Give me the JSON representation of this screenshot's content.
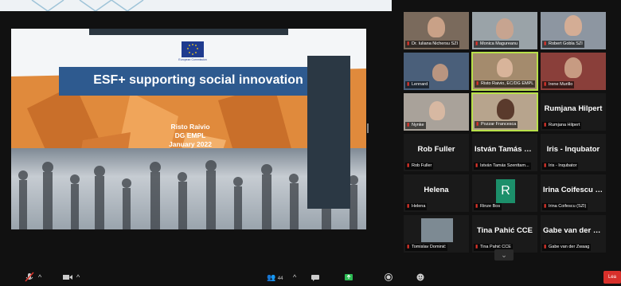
{
  "slide": {
    "logo_caption": "European Commission",
    "title": "ESF+ supporting social innovation",
    "presenter_name": "Risto Raivio",
    "presenter_dept": "DG EMPL",
    "presenter_date": "January 2022"
  },
  "gallery": {
    "tiles": [
      {
        "label": "Dr. Iuliana Nichersu SZI",
        "big": ""
      },
      {
        "label": "Monica Magureanu",
        "big": ""
      },
      {
        "label": "Robert Gobla SZI",
        "big": ""
      },
      {
        "label": "Lennard",
        "big": ""
      },
      {
        "label": "Risto Raivio, EC/DG EMPL",
        "big": ""
      },
      {
        "label": "Irene Murillo",
        "big": ""
      },
      {
        "label": "Nynke",
        "big": ""
      },
      {
        "label": "Pozzar Francesca",
        "big": ""
      },
      {
        "label": "Rumjana Hilpert",
        "big": "Rumjana Hilpert"
      },
      {
        "label": "Rob Fuller",
        "big": "Rob Fuller"
      },
      {
        "label": "István Tamás Szenttam...",
        "big": "István Tamás Sz..."
      },
      {
        "label": "Iris - Inqubator",
        "big": "Iris - Inqubator"
      },
      {
        "label": "Helena",
        "big": "Helena"
      },
      {
        "label": "Rinze Bos",
        "big": "",
        "avatar": "R"
      },
      {
        "label": "Irina Coifescu (SZI)",
        "big": "Irina Coifescu (S..."
      },
      {
        "label": "Tomislav Dominić",
        "big": ""
      },
      {
        "label": "Tina Pahić CCE",
        "big": "Tina Pahić CCE"
      },
      {
        "label": "Gabe van der Zwaag",
        "big": "Gabe van der Z..."
      }
    ]
  },
  "toolbar": {
    "participants_count": "44",
    "leave_label": "Lea"
  },
  "colors": {
    "active_speaker_border": "#b8e04a",
    "muted_mic": "#e0342b",
    "leave_button": "#d8302b",
    "slide_orange": "#e08a3c"
  }
}
